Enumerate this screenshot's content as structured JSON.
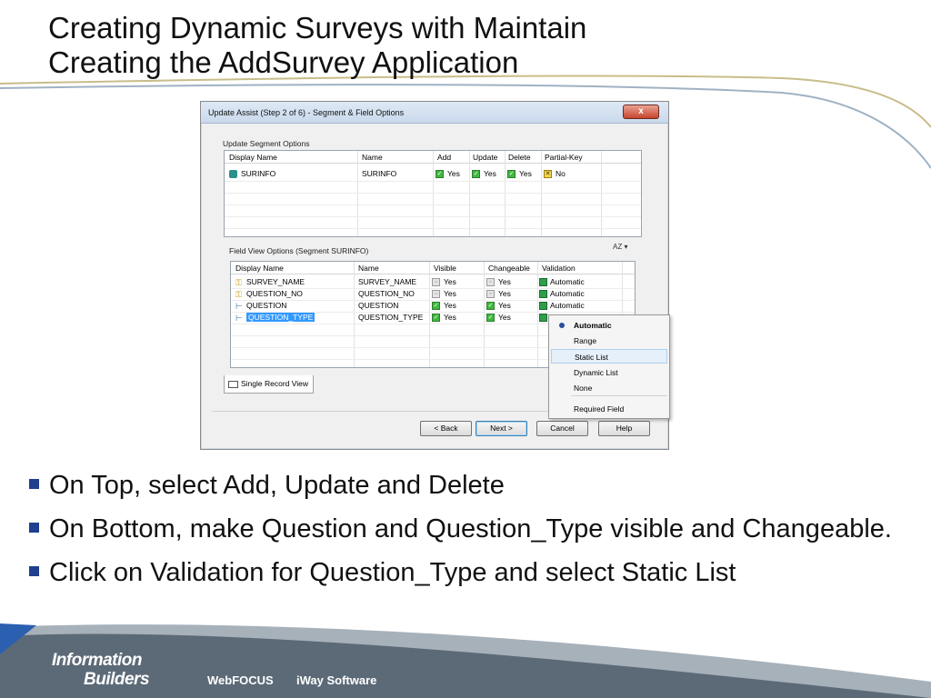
{
  "slide": {
    "title_line1": "Creating Dynamic Surveys with Maintain",
    "title_line2": "Creating the AddSurvey Application"
  },
  "dialog": {
    "title": "Update Assist (Step 2 of 6) - Segment & Field Options",
    "close_label": "x",
    "segment_group_label": "Update Segment Options",
    "segment_columns": [
      "Display Name",
      "Name",
      "Add",
      "Update",
      "Delete",
      "Partial-Key"
    ],
    "segment_rows": [
      {
        "display": "SURINFO",
        "name": "SURINFO",
        "add": "Yes",
        "update": "Yes",
        "delete": "Yes",
        "partial": "No"
      }
    ],
    "field_group_label": "Field View Options (Segment SURINFO)",
    "field_columns": [
      "Display Name",
      "Name",
      "Visible",
      "Changeable",
      "Validation"
    ],
    "field_rows": [
      {
        "display": "SURVEY_NAME",
        "name": "SURVEY_NAME",
        "visible": "Yes",
        "changeable": "Yes",
        "validation": "Automatic"
      },
      {
        "display": "QUESTION_NO",
        "name": "QUESTION_NO",
        "visible": "Yes",
        "changeable": "Yes",
        "validation": "Automatic"
      },
      {
        "display": "QUESTION",
        "name": "QUESTION",
        "visible": "Yes",
        "changeable": "Yes",
        "validation": "Automatic"
      },
      {
        "display": "QUESTION_TYPE",
        "name": "QUESTION_TYPE",
        "visible": "Yes",
        "changeable": "Yes",
        "validation": ""
      }
    ],
    "tab_label": "Single Record View",
    "buttons": {
      "back": "< Back",
      "next": "Next >",
      "cancel": "Cancel",
      "help": "Help"
    },
    "sort_label": "AZ"
  },
  "context_menu": {
    "items": [
      "Automatic",
      "Range",
      "Static List",
      "Dynamic List",
      "None",
      "Required Field"
    ],
    "selected": "Automatic",
    "highlighted": "Static List"
  },
  "bullets": [
    "On Top, select Add, Update and Delete",
    "On Bottom, make Question and Question_Type visible and Changeable.",
    "Click on Validation for Question_Type and select Static List"
  ],
  "footer": {
    "logo_line1": "Information",
    "logo_line2": "Builders",
    "links": [
      "WebFOCUS",
      "iWay Software"
    ]
  },
  "colors": {
    "bullet": "#1f3f8f",
    "footer_dark": "#5c6a78",
    "footer_light": "#a7b1ba",
    "menu_highlight": "#e6f0fa"
  }
}
